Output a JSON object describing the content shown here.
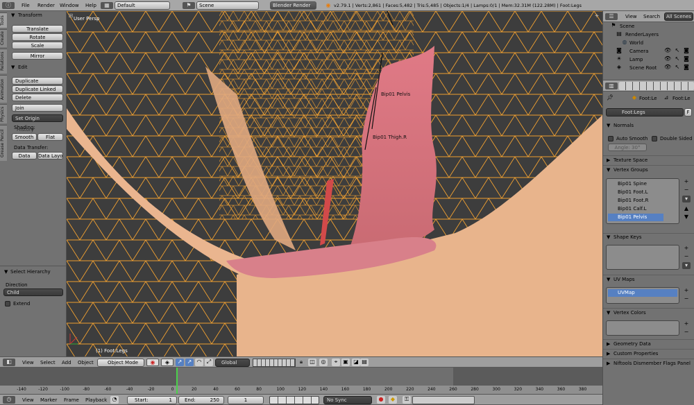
{
  "top": {
    "menus": [
      "File",
      "Render",
      "Window",
      "Help"
    ],
    "layout": "Default",
    "scene": "Scene",
    "engine": "Blender Render",
    "status": "v2.79.1 | Verts:2,861 | Faces:5,482 | Tris:5,485 | Objects:1/4 | Lamps:0/1 | Mem:32.31M (122.28M) | Foot:Legs"
  },
  "toolshelf": {
    "tabs": [
      "Tools",
      "Create",
      "Relations",
      "Animation",
      "Physics",
      "Grease Pencil"
    ],
    "transform_title": "Transform",
    "translate": "Translate",
    "rotate": "Rotate",
    "scale": "Scale",
    "mirror": "Mirror",
    "edit_title": "Edit",
    "duplicate": "Duplicate",
    "duplicate_linked": "Duplicate Linked",
    "delete": "Delete",
    "join": "Join",
    "set_origin": "Set Origin",
    "shading_label": "Shading:",
    "history_label": "History",
    "smooth": "Smooth",
    "flat": "Flat",
    "data_transfer": "Data Transfer:",
    "data": "Data",
    "data_layo": "Data Layo",
    "op_title": "Select Hierarchy",
    "direction_label": "Direction",
    "direction_value": "Child",
    "extend": "Extend"
  },
  "viewport": {
    "persp": "User Persp",
    "object_label": "(1) Foot:Legs",
    "bone_pelvis": "Bip01 Pelvis",
    "bone_thigh": "Bip01 Thigh.R",
    "wire_color": "#f0a030",
    "bg": "#3d3d3d",
    "skin": "#eab58f"
  },
  "header3d": {
    "view": "View",
    "select": "Select",
    "add": "Add",
    "object": "Object",
    "mode": "Object Mode",
    "orientation": "Global"
  },
  "timeline": {
    "ticks": [
      "-140",
      "-120",
      "-100",
      "-80",
      "-60",
      "-40",
      "-20",
      "0",
      "20",
      "40",
      "60",
      "80",
      "100",
      "120",
      "140",
      "160",
      "180",
      "200",
      "220",
      "240",
      "260",
      "280",
      "300",
      "320",
      "340",
      "360",
      "380"
    ],
    "view": "View",
    "marker": "Marker",
    "frame": "Frame",
    "playback": "Playback",
    "start": "Start:",
    "start_val": "1",
    "end": "End:",
    "end_val": "250",
    "current": "1",
    "sync": "No Sync"
  },
  "outliner": {
    "view": "View",
    "search": "Search",
    "all_scenes": "All Scenes",
    "items": [
      "Scene",
      "RenderLayers",
      "World",
      "Camera",
      "Lamp",
      "Scene Root"
    ]
  },
  "properties": {
    "crumb1": "Foot:Le",
    "crumb2": "Foot:Le",
    "mesh_name": "Foot:Legs",
    "f": "F",
    "normals": "Normals",
    "auto_smooth": "Auto Smooth",
    "double_sided": "Double Sided",
    "angle": "Angle:",
    "angle_val": "30°",
    "texture_space": "Texture Space",
    "vertex_groups": "Vertex Groups",
    "groups": [
      "Bip01 Spine",
      "Bip01 Foot.L",
      "Bip01 Foot.R",
      "Bip01 Calf.L",
      "Bip01 Pelvis"
    ],
    "shape_keys": "Shape Keys",
    "uv_maps": "UV Maps",
    "uvmap": "UVMap",
    "vertex_colors": "Vertex Colors",
    "geometry_data": "Geometry Data",
    "custom_properties": "Custom Properties",
    "niftools": "Niftools Dismember Flags Panel"
  }
}
